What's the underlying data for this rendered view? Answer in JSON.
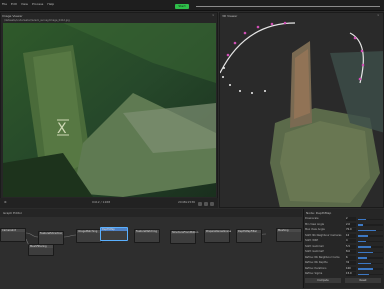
{
  "menu": [
    "File",
    "Edit",
    "View",
    "Process",
    "Help"
  ],
  "toolbar": {
    "compute_label": "Start"
  },
  "image_viewer": {
    "title": "Image Viewer",
    "path": "/datasets/underwater/wreck_survey/image_0412.jpg",
    "close": "×",
    "frame_label": "0412 / 1268",
    "resolution": "2048x1536"
  },
  "viewer3d": {
    "title": "3D Viewer",
    "close": "×"
  },
  "graph": {
    "title": "Graph Editor",
    "nodes": [
      {
        "label": "CameraInit"
      },
      {
        "label": "FeatureExtraction"
      },
      {
        "label": "ImageMatching"
      },
      {
        "label": "FeatureMatching"
      },
      {
        "label": "StructureFromMotion"
      },
      {
        "label": "PrepareDenseScene"
      },
      {
        "label": "DepthMap"
      },
      {
        "label": "DepthMapFilter"
      },
      {
        "label": "Meshing"
      },
      {
        "label": "MeshFiltering"
      },
      {
        "label": "Texturing"
      }
    ]
  },
  "inspector": {
    "title": "Node: DepthMap",
    "params": [
      {
        "label": "Downscale",
        "value": "2",
        "fill": 0.3
      },
      {
        "label": "Min View Angle",
        "value": "2.0",
        "fill": 0.2
      },
      {
        "label": "Max View Angle",
        "value": "70.0",
        "fill": 0.7
      },
      {
        "label": "SGM: Nb Neighbour Cameras",
        "value": "10",
        "fill": 0.4
      },
      {
        "label": "SGM: WSH",
        "value": "4",
        "fill": 0.3
      },
      {
        "label": "SGM: GammaC",
        "value": "5.5",
        "fill": 0.5
      },
      {
        "label": "SGM: GammaP",
        "value": "8.0",
        "fill": 0.6
      },
      {
        "label": "Refine: Nb Neighbour Cams",
        "value": "6",
        "fill": 0.35
      },
      {
        "label": "Refine: Nb Depths",
        "value": "31",
        "fill": 0.5
      },
      {
        "label": "Refine: Iterations",
        "value": "100",
        "fill": 0.6
      },
      {
        "label": "Refine: Sigma",
        "value": "15.0",
        "fill": 0.45
      }
    ],
    "buttons": [
      "Compute",
      "Reset"
    ]
  }
}
